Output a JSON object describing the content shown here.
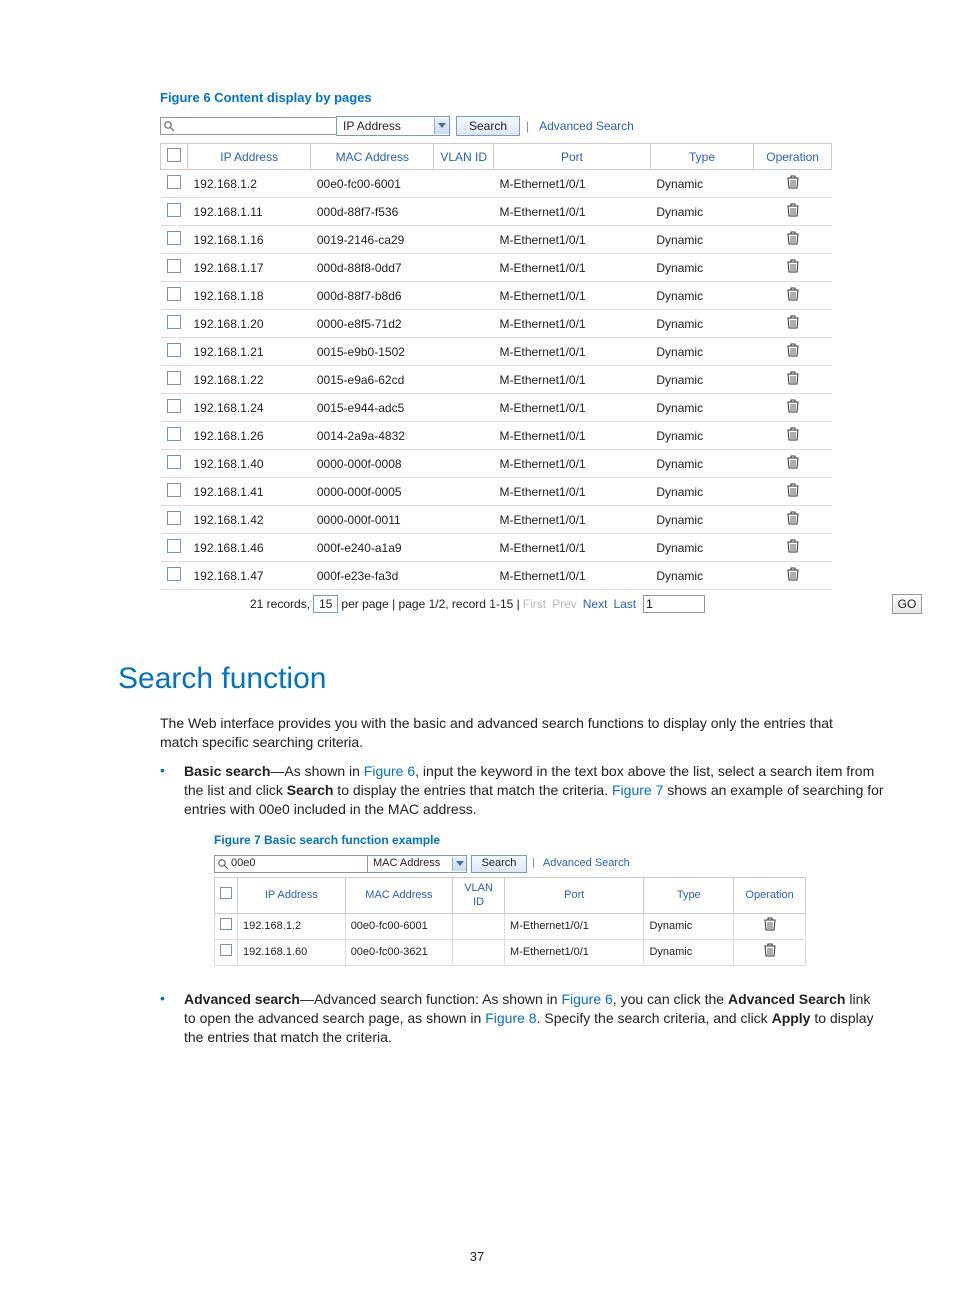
{
  "figure6": {
    "caption": "Figure 6 Content display by pages",
    "search": {
      "input_value": "",
      "dropdown": "IP Address",
      "button": "Search",
      "advanced": "Advanced Search"
    },
    "headers": {
      "ip": "IP Address",
      "mac": "MAC Address",
      "vlan": "VLAN ID",
      "port": "Port",
      "type": "Type",
      "op": "Operation"
    },
    "rows": [
      {
        "ip": "192.168.1.2",
        "mac": "00e0-fc00-6001",
        "vlan": "",
        "port": "M-Ethernet1/0/1",
        "type": "Dynamic"
      },
      {
        "ip": "192.168.1.11",
        "mac": "000d-88f7-f536",
        "vlan": "",
        "port": "M-Ethernet1/0/1",
        "type": "Dynamic"
      },
      {
        "ip": "192.168.1.16",
        "mac": "0019-2146-ca29",
        "vlan": "",
        "port": "M-Ethernet1/0/1",
        "type": "Dynamic"
      },
      {
        "ip": "192.168.1.17",
        "mac": "000d-88f8-0dd7",
        "vlan": "",
        "port": "M-Ethernet1/0/1",
        "type": "Dynamic"
      },
      {
        "ip": "192.168.1.18",
        "mac": "000d-88f7-b8d6",
        "vlan": "",
        "port": "M-Ethernet1/0/1",
        "type": "Dynamic"
      },
      {
        "ip": "192.168.1.20",
        "mac": "0000-e8f5-71d2",
        "vlan": "",
        "port": "M-Ethernet1/0/1",
        "type": "Dynamic"
      },
      {
        "ip": "192.168.1.21",
        "mac": "0015-e9b0-1502",
        "vlan": "",
        "port": "M-Ethernet1/0/1",
        "type": "Dynamic"
      },
      {
        "ip": "192.168.1.22",
        "mac": "0015-e9a6-62cd",
        "vlan": "",
        "port": "M-Ethernet1/0/1",
        "type": "Dynamic"
      },
      {
        "ip": "192.168.1.24",
        "mac": "0015-e944-adc5",
        "vlan": "",
        "port": "M-Ethernet1/0/1",
        "type": "Dynamic"
      },
      {
        "ip": "192.168.1.26",
        "mac": "0014-2a9a-4832",
        "vlan": "",
        "port": "M-Ethernet1/0/1",
        "type": "Dynamic"
      },
      {
        "ip": "192.168.1.40",
        "mac": "0000-000f-0008",
        "vlan": "",
        "port": "M-Ethernet1/0/1",
        "type": "Dynamic"
      },
      {
        "ip": "192.168.1.41",
        "mac": "0000-000f-0005",
        "vlan": "",
        "port": "M-Ethernet1/0/1",
        "type": "Dynamic"
      },
      {
        "ip": "192.168.1.42",
        "mac": "0000-000f-0011",
        "vlan": "",
        "port": "M-Ethernet1/0/1",
        "type": "Dynamic"
      },
      {
        "ip": "192.168.1.46",
        "mac": "000f-e240-a1a9",
        "vlan": "",
        "port": "M-Ethernet1/0/1",
        "type": "Dynamic"
      },
      {
        "ip": "192.168.1.47",
        "mac": "000f-e23e-fa3d",
        "vlan": "",
        "port": "M-Ethernet1/0/1",
        "type": "Dynamic"
      }
    ],
    "pager": {
      "records": "21 records,",
      "per_page_value": "15",
      "per_page_text": "per page | page 1/2, record 1-15 |",
      "first": "First",
      "prev": "Prev",
      "next": "Next",
      "last": "Last",
      "page_input": "1",
      "go": "GO"
    }
  },
  "section": {
    "title": "Search function",
    "intro": "The Web interface provides you with the basic and advanced search functions to display only the entries that match specific searching criteria.",
    "bullet1_label": "Basic search",
    "bullet1_a": "—As shown in ",
    "bullet1_link6": "Figure 6",
    "bullet1_b": ", input the keyword in the text box above the list, select a search item from the list and click ",
    "bullet1_search": "Search",
    "bullet1_c": " to display the entries that match the criteria. ",
    "bullet1_link7": "Figure 7",
    "bullet1_d": " shows an example of searching for entries with 00e0 included in the MAC address.",
    "bullet2_label": "Advanced search",
    "bullet2_a": "—Advanced search function: As shown in ",
    "bullet2_link6": "Figure 6",
    "bullet2_b": ", you can click the ",
    "bullet2_adv1": "Advanced Search",
    "bullet2_c": " link to open the advanced search page, as shown in ",
    "bullet2_link8": "Figure 8",
    "bullet2_d": ". Specify the search criteria, and click ",
    "bullet2_apply": "Apply",
    "bullet2_e": " to display the entries that match the criteria."
  },
  "figure7": {
    "caption": "Figure 7 Basic search function example",
    "search": {
      "input_value": "00e0",
      "dropdown": "MAC Address",
      "button": "Search",
      "advanced": "Advanced Search"
    },
    "headers": {
      "ip": "IP Address",
      "mac": "MAC Address",
      "vlan": "VLAN ID",
      "port": "Port",
      "type": "Type",
      "op": "Operation"
    },
    "rows": [
      {
        "ip": "192.168.1.2",
        "mac": "00e0-fc00-6001",
        "vlan": "",
        "port": "M-Ethernet1/0/1",
        "type": "Dynamic"
      },
      {
        "ip": "192.168.1.60",
        "mac": "00e0-fc00-3621",
        "vlan": "",
        "port": "M-Ethernet1/0/1",
        "type": "Dynamic"
      }
    ]
  },
  "page_number": "37"
}
